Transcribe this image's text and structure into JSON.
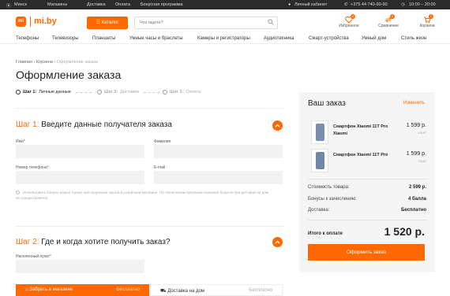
{
  "topbar": {
    "city": "Минск",
    "links": [
      "Магазины",
      "Доставка",
      "Оплата",
      "Бонусная программа"
    ],
    "account": "Личный кабинет",
    "phone": "+375 44 740-90-90",
    "hours": "10:00 – 20:00"
  },
  "header": {
    "logo_mi": "mi",
    "logo_text": "mi.by",
    "catalog_label": "Каталог",
    "search_placeholder": "Что ищете?",
    "favorites_label": "Избранное",
    "favorites_count": "0",
    "compare_label": "Сравнение",
    "compare_count": "0",
    "cart_label": "Корзина",
    "cart_count": "2",
    "accent_color": "#ff6900"
  },
  "nav": [
    "Телефоны",
    "Телевизоры",
    "Планшеты",
    "Умные часы и браслеты",
    "Камеры и регистраторы",
    "Аудиотехника",
    "Смарт-устройства",
    "Умный дом",
    "Стиль жизн"
  ],
  "breadcrumb": {
    "home": "Главная",
    "cart": "Корзина",
    "current": "Оформление заказа"
  },
  "page_title": "Оформление заказа",
  "steps": [
    {
      "num": "Шаг 1:",
      "label": "Личные данные"
    },
    {
      "num": "Шаг 2:",
      "label": "Доставка"
    },
    {
      "num": "Шаг 3:",
      "label": "Оплата"
    }
  ],
  "section1": {
    "step": "Шаг 1:",
    "title": "Введите данные получателя заказа",
    "name_label": "Имя",
    "surname_label": "Фамилия",
    "phone_label": "Номер телефона",
    "email_label": "E-mail",
    "required_mark": "*",
    "note": "Использовать бонусы можно только при получении заказа в розничном магазине. По техническим причинам списание бонусов при доставке на дом не осуществляется."
  },
  "section2": {
    "step": "Шаг 2:",
    "title": "Где и когда хотите получить заказ?",
    "city_label": "Населенный пункт",
    "pickup_label": "Забрать в магазине",
    "pickup_price": "Бесплатно",
    "delivery_label": "Доставка на дом",
    "delivery_price": "Бесплатно"
  },
  "order": {
    "title": "Ваш заказ",
    "edit_label": "Изменить",
    "items": [
      {
        "name": "Смартфон Xiaomi 11T Pro Xiaomi",
        "price": "1 599 р.",
        "qty": "x1шт",
        "color": "#7a8fb0"
      },
      {
        "name": "Смартфон Xiaomi 11T Pro",
        "price": "1 599 р.",
        "qty": "x1шт",
        "color": "#6f87a8"
      }
    ],
    "goods_cost_label": "Стоимость товара:",
    "goods_cost_value": "2 599 р.",
    "bonus_label": "Бонусы к зачислению:",
    "bonus_value": "4 балла",
    "delivery_label": "Доставка:",
    "delivery_value": "Бесплатно",
    "total_label": "Итого к оплате",
    "total_value": "1 520 р.",
    "submit_label": "Оформить заказ"
  }
}
